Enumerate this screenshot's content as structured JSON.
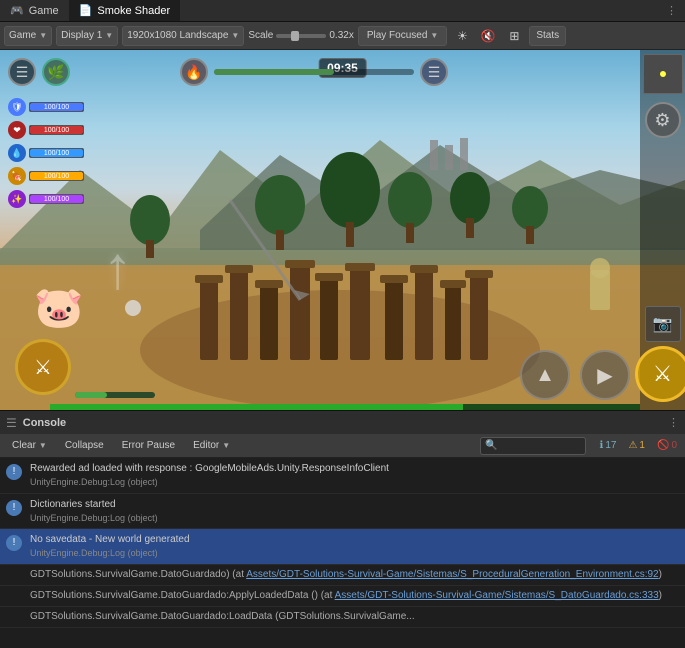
{
  "tabs": [
    {
      "id": "game",
      "label": "Game",
      "icon": "🎮",
      "active": false
    },
    {
      "id": "smoke-shader",
      "label": "Smoke Shader",
      "icon": "📄",
      "active": true
    }
  ],
  "toolbar": {
    "game_label": "Game",
    "display_label": "Display 1",
    "resolution_label": "1920x1080 Landscape",
    "scale_label": "Scale",
    "scale_value": "0.32x",
    "play_focused_label": "Play Focused",
    "stats_label": "Stats"
  },
  "hud": {
    "timer": "09:35",
    "stats": [
      {
        "color": "#4a7aff",
        "fill": "100%",
        "label": "100/100"
      },
      {
        "color": "#ff4444",
        "fill": "100%",
        "label": "100/100"
      },
      {
        "color": "#44aaff",
        "fill": "100%",
        "label": "100/100"
      },
      {
        "color": "#ffaa00",
        "fill": "100%",
        "label": "100/100"
      },
      {
        "color": "#aa44ff",
        "fill": "100%",
        "label": "100/100"
      }
    ]
  },
  "console": {
    "title": "Console",
    "buttons": {
      "clear": "Clear",
      "collapse": "Collapse",
      "error_pause": "Error Pause",
      "editor": "Editor"
    },
    "search_placeholder": "",
    "badges": {
      "info_count": "17",
      "warn_count": "1",
      "err_count": "0"
    },
    "logs": [
      {
        "type": "info",
        "main": "Rewarded ad loaded with response : GoogleMobileAds.Unity.ResponseInfoClient",
        "sub": "UnityEngine.Debug:Log (object)"
      },
      {
        "type": "info",
        "main": "Dictionaries started",
        "sub": "UnityEngine.Debug:Log (object)"
      },
      {
        "type": "info",
        "main": "No savedata - New world generated",
        "sub": "UnityEngine.Debug:Log (object)",
        "highlighted": true
      }
    ],
    "plain_logs": [
      {
        "text": "GDTSolutions.SurvivalGame.DatoGuardado) (at ",
        "link": "Assets/GDT-Solutions-Survival-Game/Sistemas/S_ProceduralGeneration_Environment.cs:92",
        "suffix": ")"
      },
      {
        "text": "GDTSolutions.SurvivalGame.DatoGuardado:ApplyLoadedData () (at ",
        "link": "Assets/GDT-Solutions-Survival-Game/Sistemas/S_DatoGuardado.cs:333",
        "suffix": ")"
      },
      {
        "text": "GDTSolutions.SurvivalGame.DatoGuardado:LoadData (GDTSolutions.SurvivalGame..."
      }
    ]
  }
}
